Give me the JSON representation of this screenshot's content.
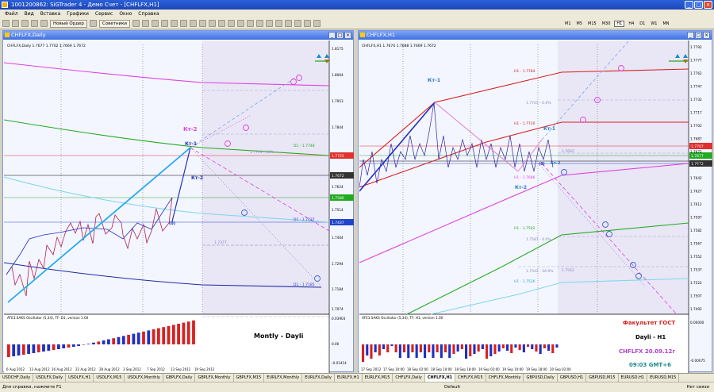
{
  "app": {
    "title": "1001200862: SiGTrader 4 - Демо Счет - [CHFLFX,H1]"
  },
  "menu": [
    "Файл",
    "Вид",
    "Вставка",
    "Графики",
    "Сервис",
    "Окно",
    "Справка"
  ],
  "toolbar": {
    "new_order": "Новый Ордер",
    "advisors": "Советники",
    "timeframes": [
      "M1",
      "M5",
      "M15",
      "M30",
      "H1",
      "H4",
      "D1",
      "W1",
      "MN"
    ],
    "active_tf": "H1"
  },
  "left_window": {
    "title": "CHFLFX,Daily",
    "header": "CHFLFX,Daily  1.7677 1.7702 1.7669 1.7672",
    "price_axis": [
      "1.8175",
      "1.8064",
      "1.7953",
      "1.7844",
      "1.7735",
      "1.7624",
      "1.7514",
      "1.7404",
      "1.7294",
      "1.7184",
      "1.7074"
    ],
    "price_badges": {
      "red": "1.7725",
      "dark": "1.7672",
      "green": "1.7586",
      "blue": "1.7437"
    },
    "date_axis": [
      "6 Aug 2012",
      "13 Aug 2012",
      "16 Aug 2012",
      "22 Aug 2012",
      "28 Aug 2012",
      "3 Sep 2012",
      "7 Sep 2012",
      "13 Sep 2012",
      "19 Sep 2012"
    ],
    "labels": {
      "kt2_pink": "Кт-2",
      "kt1": "Кт-1",
      "kt2_blue": "Кт-2",
      "zero": "(0)",
      "d1_green": "D1 - 1.7748",
      "d1_blue": "D1 - 1.7437",
      "d1_purple": "D1 - 1.7185",
      "fib_1": "1.7745 - 50%",
      "fib_2": "1.7377"
    },
    "osc_header": "ATE3.SAKS Oscillator (5,34), TF: D1, version 1.00",
    "osc_axis": [
      "0.03903",
      "0.00",
      "-0.01414"
    ],
    "note": "Montly - Dayli"
  },
  "right_window": {
    "title": "CHFLFX,H1",
    "header": "CHFLFX,H1  1.7674 1.7688 1.7669 1.7672",
    "price_axis": [
      "1.7792",
      "1.7777",
      "1.7762",
      "1.7747",
      "1.7732",
      "1.7717",
      "1.7702",
      "1.7687",
      "1.7672",
      "1.7657",
      "1.7642",
      "1.7627",
      "1.7612",
      "1.7597",
      "1.7582",
      "1.7567",
      "1.7552",
      "1.7537",
      "1.7522",
      "1.7507",
      "1.7492"
    ],
    "price_badges": {
      "red": "1.7707",
      "green": "1.7677",
      "dark": "1.7672"
    },
    "date_axis": [
      "17 Sep 2012",
      "17 Sep 10:00",
      "18 Sep 02:00",
      "18 Sep 10:00",
      "18 Sep 18:00",
      "19 Sep 02:00",
      "19 Sep 10:00",
      "19 Sep 18:00",
      "20 Sep 02:00"
    ],
    "labels": {
      "kt1_top": "Кт-1",
      "kt1_right": "Кт-1",
      "kt2_a": "Кт-2",
      "kt2_b": "Кт-2",
      "zero": "(0)",
      "h1_red1": "H1 - 1.7784",
      "h1_red2": "H1 - 1.7720",
      "h1_pink": "H1 - 1.7686",
      "h1_green": "H1 - 1.7592",
      "h1_cyan": "H1 - 1.7526",
      "fib_a": "1.7745 - 0.0%",
      "fib_b": "1.7682",
      "fib_c": "1.7581 - 0.0%",
      "fib_d": "1.7542 - 26.9%",
      "fib_e": "1.7542"
    },
    "osc_header": "ATE3.SAKS Oscillator (5,34), TF: H1, version 1.00",
    "osc_axis": [
      "0.00000",
      "-0.00075"
    ],
    "note": {
      "line1": "Факультет ГОСТ",
      "line2": "Dayli - H1",
      "line3": "CHFLFX 20.09.12г",
      "line4": "09:03 GMT+6"
    }
  },
  "tabs": [
    "USDCHF,Daily",
    "USDLFX,Daily",
    "USDLFX,H1",
    "USDLFX,M15",
    "USDLFX,Monthly",
    "GBPLFX,Daily",
    "GBPLFX,Monthly",
    "GBPLFX,M15",
    "EURLFX,Monthly",
    "EURLFX,Daily",
    "EURLFX,H1",
    "EURLFX,M15",
    "CHFLFX,Daily",
    "CHFLFX,H1",
    "CHFLFX,M15",
    "CHFLFX,Monthly",
    "GBPUSD,Daily",
    "GBPUSD,H1",
    "GBPUSD,M15",
    "EURUSD,H1",
    "EURUSD,M15"
  ],
  "active_tab": "CHFLFX,H1",
  "status": {
    "left": "Для справки, нажмите F1",
    "mid": "Default",
    "right": "Нет связи"
  },
  "colors": {
    "pink": "#e040e0",
    "blue": "#1a3ccc",
    "cyan": "#22aaee",
    "green": "#22aa22",
    "red": "#d82020"
  }
}
